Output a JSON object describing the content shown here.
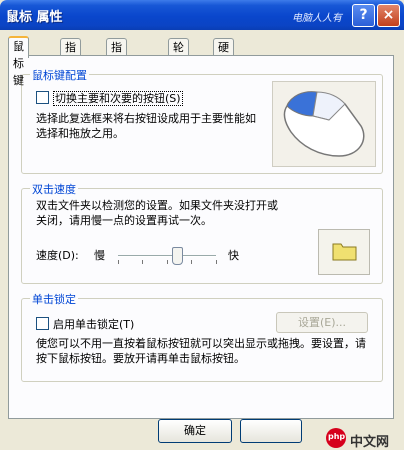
{
  "window": {
    "title": "鼠标 属性",
    "watermark": "电脑人人有",
    "help_label": "?",
    "close_label": "×"
  },
  "tabs": [
    {
      "label": "鼠标键",
      "active": true
    },
    {
      "label": "指针",
      "active": false
    },
    {
      "label": "指针选项",
      "active": false
    },
    {
      "label": "轮",
      "active": false
    },
    {
      "label": "硬件",
      "active": false
    }
  ],
  "button_config": {
    "legend": "鼠标键配置",
    "checkbox_label": "切换主要和次要的按钮(S)",
    "checked": false,
    "description": "选择此复选框来将右按钮设成用于主要性能如选择和拖放之用。"
  },
  "double_click": {
    "legend": "双击速度",
    "description": "双击文件夹以检测您的设置。如果文件夹没打开或关闭，请用慢一点的设置再试一次。",
    "speed_label": "速度(D):",
    "slow_label": "慢",
    "fast_label": "快",
    "slider_value_percent": 50
  },
  "click_lock": {
    "legend": "单击锁定",
    "checkbox_label": "启用单击锁定(T)",
    "checked": false,
    "settings_button": "设置(E)...",
    "description": "使您可以不用一直按着鼠标按钮就可以突出显示或拖拽。要设置，请按下鼠标按钮。要放开请再单击鼠标按钮。"
  },
  "footer": {
    "ok_button": "确定",
    "logo_text": "中文网",
    "logo_mark": "php"
  },
  "colors": {
    "titlebar": "#0a46cc",
    "legend_text": "#0046d5",
    "active_tab_accent": "#f5b43a",
    "folder": "#f0e070"
  },
  "icons": [
    "help-icon",
    "close-icon",
    "mouse-icon",
    "folder-icon"
  ]
}
